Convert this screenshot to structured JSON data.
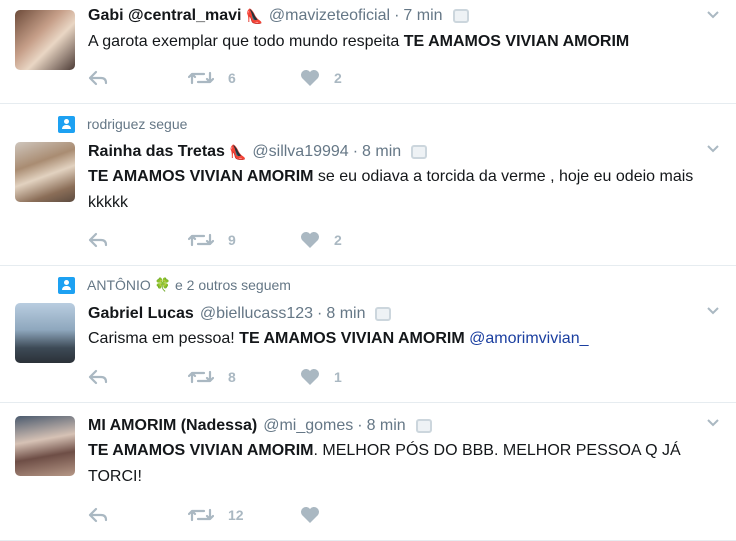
{
  "tweets": [
    {
      "context": null,
      "name": "Gabi @central_mavi",
      "name_emoji": "👠",
      "handle": "@mavizeteoficial",
      "time": "7 min",
      "text_plain": "A garota exemplar que todo mundo respeita ",
      "text_bold": "TE AMAMOS VIVIAN AMORIM",
      "text_after": "",
      "retweets": "6",
      "likes": "2"
    },
    {
      "context": "rodriguez segue",
      "name": "Rainha das Tretas",
      "name_emoji": "👠",
      "handle": "@sillva19994",
      "time": "8 min",
      "text_bold": "TE AMAMOS VIVIAN AMORIM",
      "text_after": " se eu odiava a torcida da verme , hoje eu odeio mais kkkkk",
      "retweets": "9",
      "likes": "2"
    },
    {
      "context_name": "ANTÔNIO",
      "context_emoji": "🍀",
      "context_rest": "e 2 outros seguem",
      "name": "Gabriel Lucas",
      "handle": "@biellucass123",
      "time": "8 min",
      "text_plain": "Carisma em pessoa! ",
      "text_bold": "TE AMAMOS VIVIAN AMORIM",
      "mention": " @amorimvivian_",
      "retweets": "8",
      "likes": "1"
    },
    {
      "context": null,
      "name": "MI AMORIM (Nadessa)",
      "handle": "@mi_gomes",
      "time": "8 min",
      "text_bold": "TE AMAMOS VIVIAN AMORIM",
      "text_after": ". MELHOR PÓS DO BBB. MELHOR PESSOA Q JÁ TORCI!",
      "retweets": "12",
      "likes": ""
    }
  ],
  "icons": {
    "reply": "reply-icon",
    "retweet": "retweet-icon",
    "like": "heart-icon",
    "caret": "chevron-down-icon",
    "context": "person-icon"
  },
  "colors": {
    "icon_gray": "#aab8c2",
    "secondary_text": "#657786",
    "mention": "#1b3fa0",
    "context_icon": "#1da1f2"
  }
}
